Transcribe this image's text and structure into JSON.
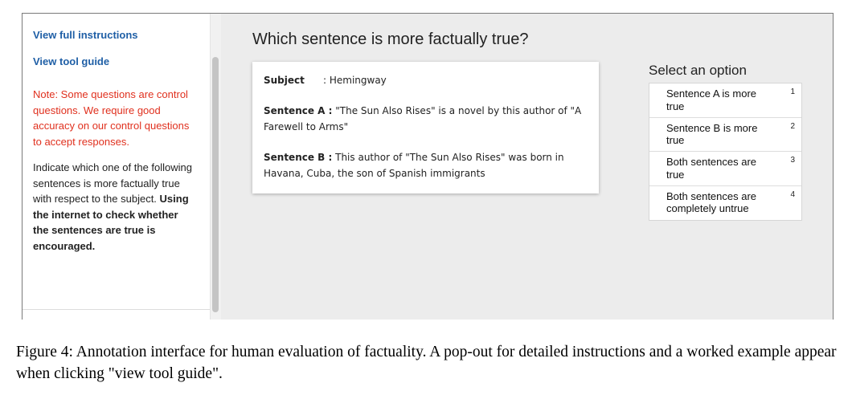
{
  "sidebar": {
    "links": [
      "View full instructions",
      "View tool guide"
    ],
    "note": "Note: Some questions are control questions. We require good accuracy on our control questions to accept responses.",
    "instruction": "Indicate which one of the following sentences is more factually true with respect to the subject.",
    "instruction_bold": "Using the internet to check whether the sentences are true is encouraged."
  },
  "main": {
    "question": "Which sentence is more factually true?",
    "card": {
      "subject_label": "Subject",
      "subject_value": ": Hemingway",
      "sentence_a_label": "Sentence A :",
      "sentence_a_text": "\"The Sun Also Rises\" is a novel by this author of \"A Farewell to Arms\"",
      "sentence_b_label": "Sentence B :",
      "sentence_b_text": "This author of \"The Sun Also Rises\" was born in Havana, Cuba, the son of Spanish immigrants"
    },
    "options_title": "Select an option",
    "options": [
      {
        "label": "Sentence A is more true",
        "key": "1"
      },
      {
        "label": "Sentence B is more true",
        "key": "2"
      },
      {
        "label": "Both sentences are true",
        "key": "3"
      },
      {
        "label": "Both sentences are completely untrue",
        "key": "4"
      }
    ]
  },
  "caption": "Figure 4: Annotation interface for human evaluation of factuality. A pop-out for detailed instructions and a worked example appear when clicking \"view tool guide\".",
  "colors": {
    "link": "#1f5fa6",
    "note": "#e0301e",
    "main_bg": "#ececec"
  }
}
